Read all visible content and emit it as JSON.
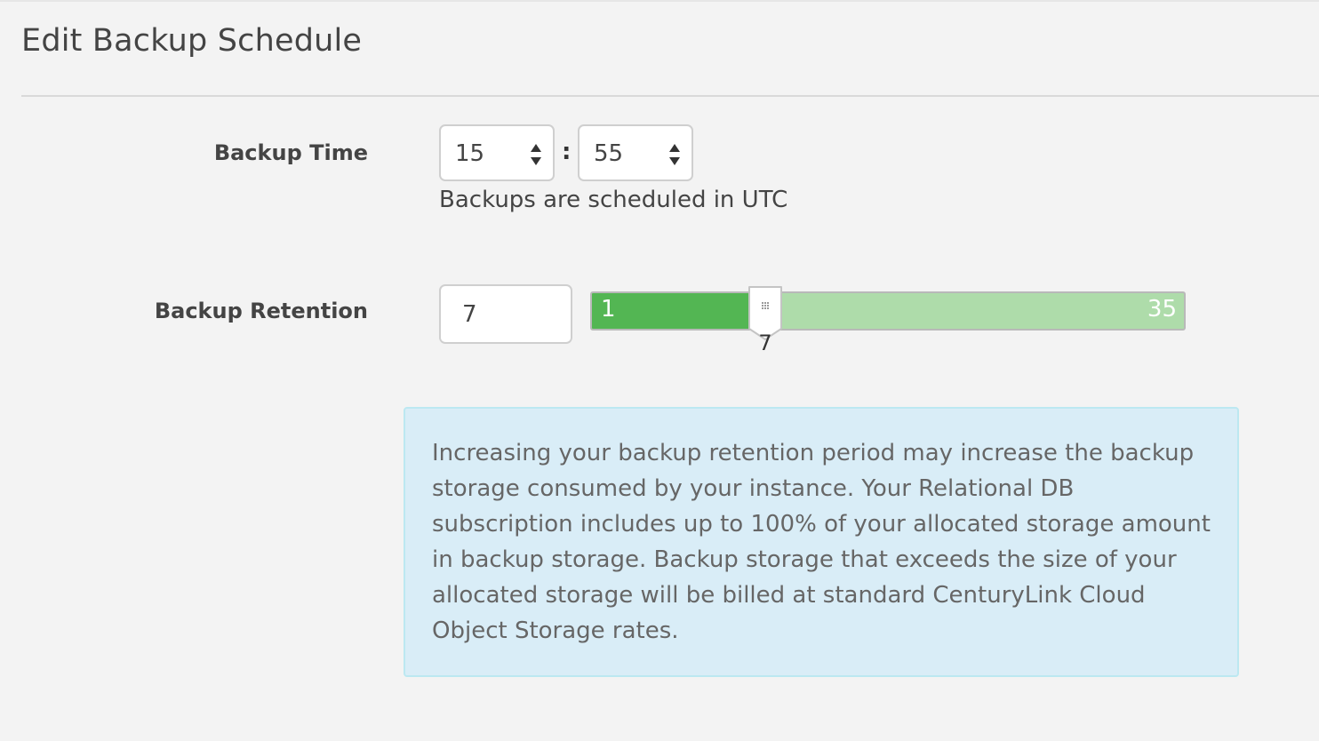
{
  "page": {
    "title": "Edit Backup Schedule"
  },
  "backup_time": {
    "label": "Backup Time",
    "hour": "15",
    "separator": ":",
    "minute": "55",
    "hint": "Backups are scheduled in UTC"
  },
  "backup_retention": {
    "label": "Backup Retention",
    "value": "7",
    "slider": {
      "min": 1,
      "max": 35,
      "value": 7,
      "min_label": "1",
      "max_label": "35",
      "value_label": "7"
    }
  },
  "info": {
    "message": "Increasing your backup retention period may increase the backup storage consumed by your instance. Your Relational DB subscription includes up to 100% of your allocated storage amount in backup storage. Backup storage that exceeds the size of your allocated storage will be billed at standard CenturyLink Cloud Object Storage rates."
  },
  "icons": {
    "spinner": "up-down-arrows-icon",
    "slider_grip": "grip-dots-icon"
  },
  "colors": {
    "slider_fill": "#53b653",
    "slider_track": "#aedcaa",
    "info_background": "#d9edf7",
    "info_border": "#bce8f1"
  }
}
